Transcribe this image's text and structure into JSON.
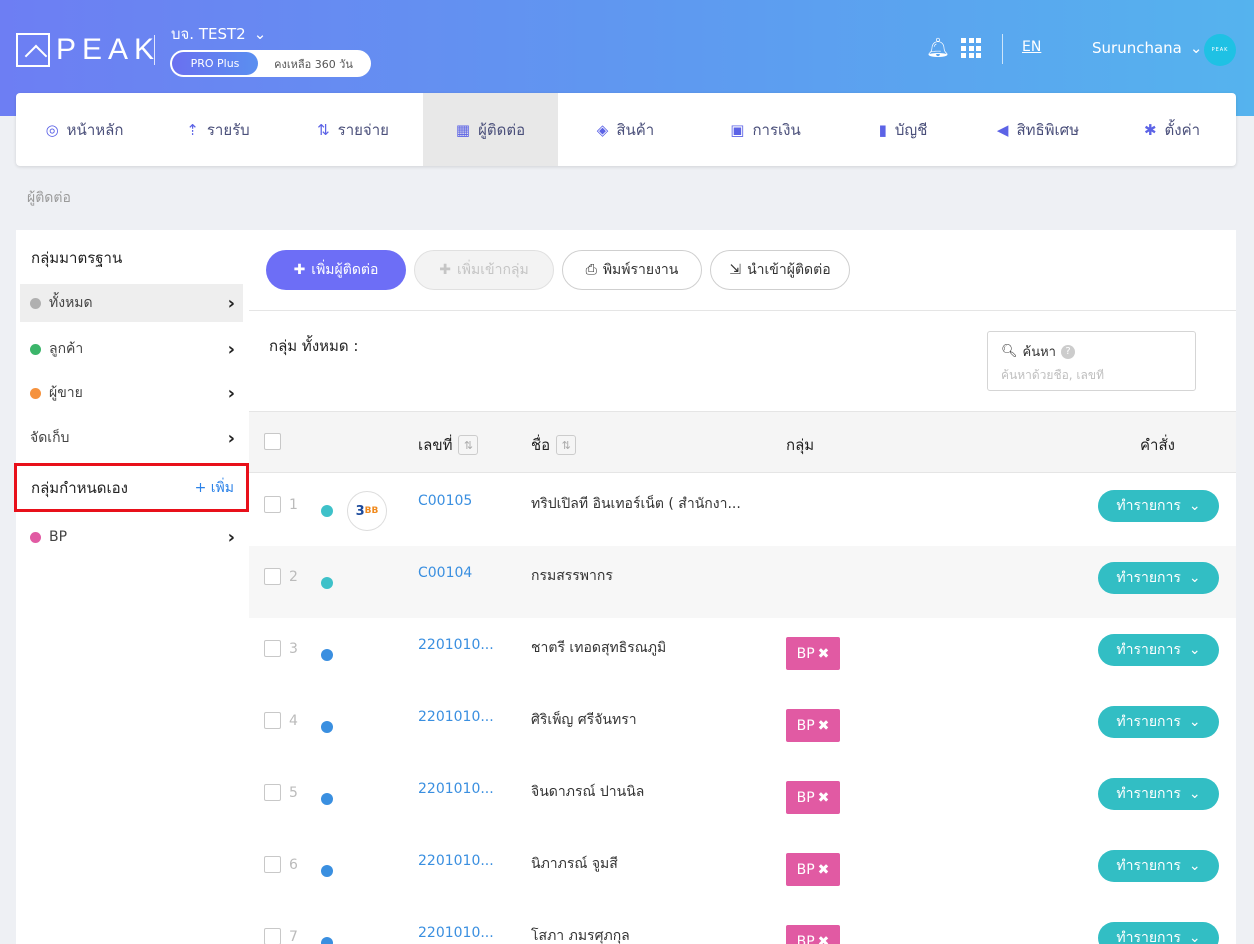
{
  "header": {
    "logo_text": "PEAK",
    "company": "บจ. TEST2",
    "plan": "PRO Plus",
    "remaining": "คงเหลือ 360 วัน",
    "lang": "EN",
    "user": "Surunchana",
    "avatar_text": "PEAK"
  },
  "nav": [
    {
      "label": "หน้าหลัก",
      "icon": "dashboard-icon",
      "glyph": "◎",
      "width": 137
    },
    {
      "label": "รายรับ",
      "icon": "income-icon",
      "glyph": "⇡",
      "width": 130
    },
    {
      "label": "รายจ่าย",
      "icon": "expense-icon",
      "glyph": "⇅",
      "width": 140
    },
    {
      "label": "ผู้ติดต่อ",
      "icon": "contacts-icon",
      "glyph": "▦",
      "width": 135,
      "active": true
    },
    {
      "label": "สินค้า",
      "icon": "product-icon",
      "glyph": "◈",
      "width": 135
    },
    {
      "label": "การเงิน",
      "icon": "money-icon",
      "glyph": "▣",
      "width": 145
    },
    {
      "label": "บัญชี",
      "icon": "account-icon",
      "glyph": "▮",
      "width": 130
    },
    {
      "label": "สิทธิพิเศษ",
      "icon": "megaphone-icon",
      "glyph": "◀",
      "width": 140
    },
    {
      "label": "ตั้งค่า",
      "icon": "gear-icon",
      "glyph": "✱",
      "width": 128
    }
  ],
  "breadcrumb": "ผู้ติดต่อ",
  "sidebar": {
    "standard_title": "กลุ่มมาตรฐาน",
    "items": [
      {
        "label": "ทั้งหมด",
        "color": "#b0b0b0"
      },
      {
        "label": "ลูกค้า",
        "color": "#3bb56a"
      },
      {
        "label": "ผู้ขาย",
        "color": "#f5923e"
      },
      {
        "label": "จัดเก็บ",
        "color": ""
      }
    ],
    "custom_title": "กลุ่มกำหนดเอง",
    "add_label": "+ เพิ่ม",
    "custom_items": [
      {
        "label": "BP",
        "color": "#e15aa3"
      }
    ]
  },
  "toolbar": {
    "add_contact": "เพิ่มผู้ติดต่อ",
    "add_to_group": "เพิ่มเข้ากลุ่ม",
    "print_report": "พิมพ์รายงาน",
    "import_contacts": "นำเข้าผู้ติดต่อ"
  },
  "group_title": "กลุ่ม ทั้งหมด :",
  "search": {
    "label": "ค้นหา",
    "placeholder": "ค้นหาด้วยชื่อ, เลขที่"
  },
  "table": {
    "headers": {
      "code": "เลขที่",
      "name": "ชื่อ",
      "group": "กลุ่ม",
      "action": "คำสั่ง"
    },
    "action_label": "ทำรายการ",
    "rows": [
      {
        "num": "1",
        "dot": "#3ec1c9",
        "code": "C00105",
        "name": "ทริปเปิลที อินเทอร์เน็ต ( สำนักงา...",
        "tag": "",
        "logo": true
      },
      {
        "num": "2",
        "dot": "#3ec1c9",
        "code": "C00104",
        "name": "กรมสรรพากร",
        "tag": ""
      },
      {
        "num": "3",
        "dot": "#3a8fe0",
        "code": "2201010...",
        "name": "ชาตรี เทอดสุทธิรณภูมิ",
        "tag": "BP"
      },
      {
        "num": "4",
        "dot": "#3a8fe0",
        "code": "2201010...",
        "name": "ศิริเพ็ญ ศรีจันทรา",
        "tag": "BP"
      },
      {
        "num": "5",
        "dot": "#3a8fe0",
        "code": "2201010...",
        "name": "จินดาภรณ์ ปานนิล",
        "tag": "BP"
      },
      {
        "num": "6",
        "dot": "#3a8fe0",
        "code": "2201010...",
        "name": "นิภาภรณ์ จูมสี",
        "tag": "BP"
      },
      {
        "num": "7",
        "dot": "#3a8fe0",
        "code": "2201010...",
        "name": "โสภา ภมรศุภกุล",
        "tag": "BP"
      }
    ]
  }
}
